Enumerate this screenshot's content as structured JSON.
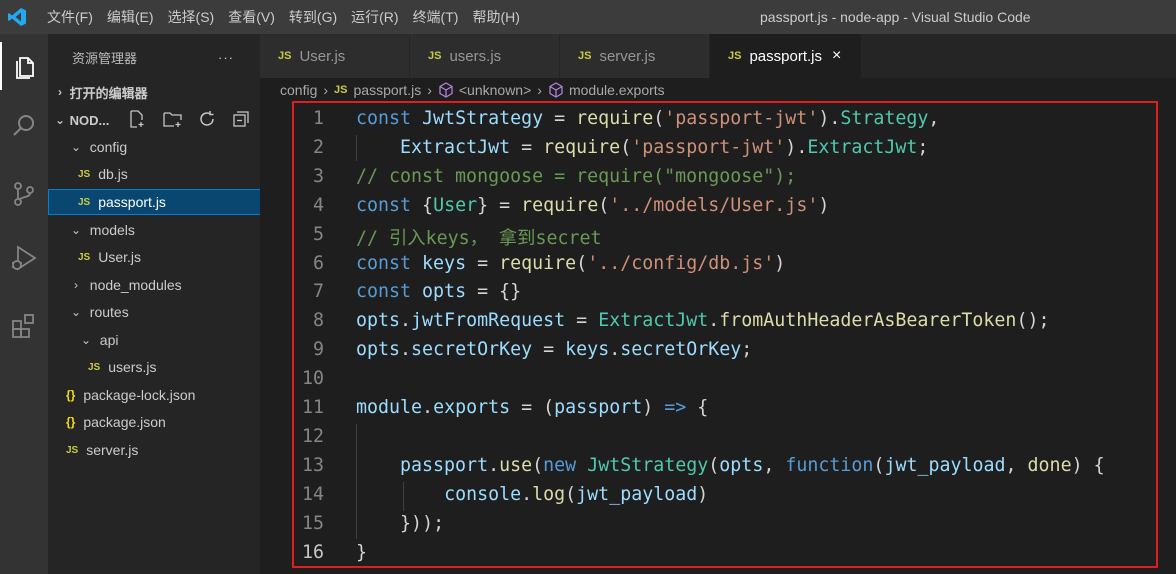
{
  "titlebar": {
    "menu": [
      "文件(F)",
      "编辑(E)",
      "选择(S)",
      "查看(V)",
      "转到(G)",
      "运行(R)",
      "终端(T)",
      "帮助(H)"
    ],
    "window_title": "passport.js - node-app - Visual Studio Code"
  },
  "colors": {
    "accent": "#007acc",
    "highlight_box": "#e11e1e",
    "selection": "#094771"
  },
  "activitybar": [
    "files-icon",
    "search-icon",
    "source-control-icon",
    "run-debug-icon",
    "extensions-icon"
  ],
  "sidebar": {
    "header": "资源管理器",
    "more": "···",
    "open_editors": "打开的编辑器",
    "project": "NOD...",
    "tree": [
      {
        "label": "config",
        "type": "folder",
        "open": true
      },
      {
        "label": "db.js",
        "type": "js"
      },
      {
        "label": "passport.js",
        "type": "js",
        "selected": true
      },
      {
        "label": "models",
        "type": "folder",
        "open": true
      },
      {
        "label": "User.js",
        "type": "js"
      },
      {
        "label": "node_modules",
        "type": "folder",
        "open": false
      },
      {
        "label": "routes",
        "type": "folder",
        "open": true
      },
      {
        "label": "api",
        "type": "folder",
        "open": true
      },
      {
        "label": "users.js",
        "type": "js"
      },
      {
        "label": "package-lock.json",
        "type": "json"
      },
      {
        "label": "package.json",
        "type": "json"
      },
      {
        "label": "server.js",
        "type": "js"
      }
    ]
  },
  "tabs": [
    {
      "label": "User.js",
      "icon": "JS",
      "active": false
    },
    {
      "label": "users.js",
      "icon": "JS",
      "active": false
    },
    {
      "label": "server.js",
      "icon": "JS",
      "active": false
    },
    {
      "label": "passport.js",
      "icon": "JS",
      "active": true,
      "close": "×"
    }
  ],
  "breadcrumbs": {
    "folder": "config",
    "file_icon": "JS",
    "file": "passport.js",
    "symbol1": "<unknown>",
    "symbol2": "module.exports"
  },
  "editor": {
    "current_line": 16,
    "lines": [
      "const JwtStrategy = require('passport-jwt').Strategy,",
      "    ExtractJwt = require('passport-jwt').ExtractJwt;",
      "// const mongoose = require(\"mongoose\");",
      "const {User} = require('../models/User.js')",
      "// 引入keys， 拿到secret",
      "const keys = require('../config/db.js')",
      "const opts = {}",
      "opts.jwtFromRequest = ExtractJwt.fromAuthHeaderAsBearerToken();",
      "opts.secretOrKey = keys.secretOrKey;",
      "",
      "module.exports = (passport) => {",
      "",
      "    passport.use(new JwtStrategy(opts, function(jwt_payload, done) {",
      "        console.log(jwt_payload)",
      "    }));",
      "}"
    ]
  }
}
